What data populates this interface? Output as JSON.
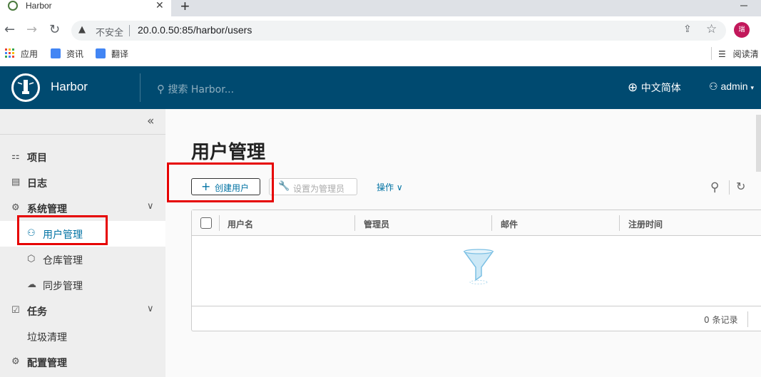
{
  "browser": {
    "tab_title": "Harbor",
    "tab_close": "✕",
    "new_tab": "+",
    "security_label": "不安全",
    "url": "20.0.0.50:85/harbor/users",
    "profile_initial": "瑞",
    "bookmarks": [
      "应用",
      "资讯",
      "翻译"
    ],
    "reading_list": "阅读清"
  },
  "header": {
    "brand": "Harbor",
    "search_placeholder": "搜索 Harbor...",
    "language": "中文简体",
    "user": "admin"
  },
  "sidebar": {
    "collapse_icon": "«",
    "items": [
      {
        "label": "项目",
        "icon": "projects-icon"
      },
      {
        "label": "日志",
        "icon": "logs-icon"
      },
      {
        "label": "系统管理",
        "icon": "admin-icon"
      },
      {
        "label": "用户管理",
        "icon": "users-icon"
      },
      {
        "label": "仓库管理",
        "icon": "registry-icon"
      },
      {
        "label": "同步管理",
        "icon": "replication-icon"
      },
      {
        "label": "任务",
        "icon": "tasks-icon"
      },
      {
        "label": "垃圾清理",
        "icon": ""
      },
      {
        "label": "配置管理",
        "icon": "config-icon"
      }
    ]
  },
  "main": {
    "title": "用户管理",
    "create_user_label": "创建用户",
    "set_admin_label": "设置为管理员",
    "operations_label": "操作",
    "columns": [
      "用户名",
      "管理员",
      "邮件",
      "注册时间"
    ],
    "record_count": "0 条记录"
  },
  "colors": {
    "header_bg": "#004a70",
    "accent": "#0072a3",
    "highlight_box": "#e60000"
  }
}
